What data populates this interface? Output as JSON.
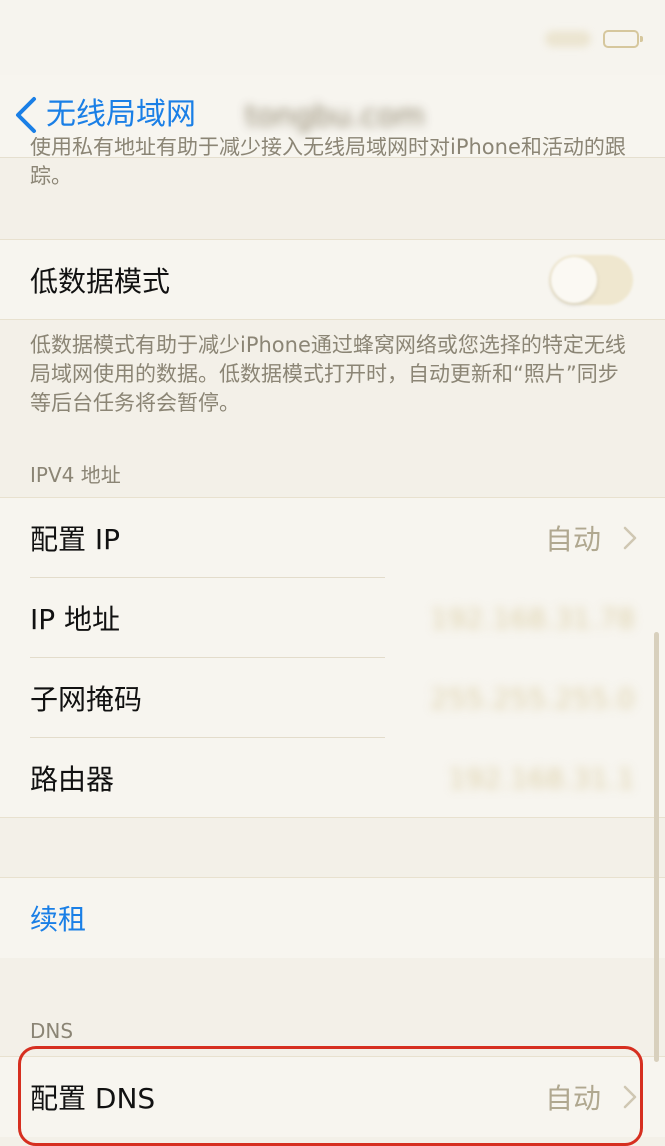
{
  "status_bar": {
    "wifi_icon": "wifi-icon",
    "battery_icon": "battery-icon"
  },
  "nav": {
    "back_label": "无线局域网",
    "title": "tongbu.com"
  },
  "private_address_footer": "使用私有地址有助于减少接入无线局域网时对iPhone和活动的跟踪。",
  "low_data_mode": {
    "label": "低数据模式",
    "enabled": false,
    "footer": "低数据模式有助于减少iPhone通过蜂窝网络或您选择的特定无线局域网使用的数据。低数据模式打开时，自动更新和“照片”同步等后台任务将会暂停。"
  },
  "ipv4": {
    "header": "IPV4 地址",
    "configure_ip": {
      "label": "配置 IP",
      "value": "自动"
    },
    "ip_address": {
      "label": "IP 地址",
      "value": "192.168.31.78"
    },
    "subnet_mask": {
      "label": "子网掩码",
      "value": "255.255.255.0"
    },
    "router": {
      "label": "路由器",
      "value": "192.168.31.1"
    }
  },
  "renew_lease": {
    "label": "续租"
  },
  "dns": {
    "header": "DNS",
    "configure_dns": {
      "label": "配置 DNS",
      "value": "自动"
    }
  },
  "colors": {
    "accent": "#1a7fe6",
    "highlight": "#d62f20",
    "background": "#f3f0e8"
  }
}
